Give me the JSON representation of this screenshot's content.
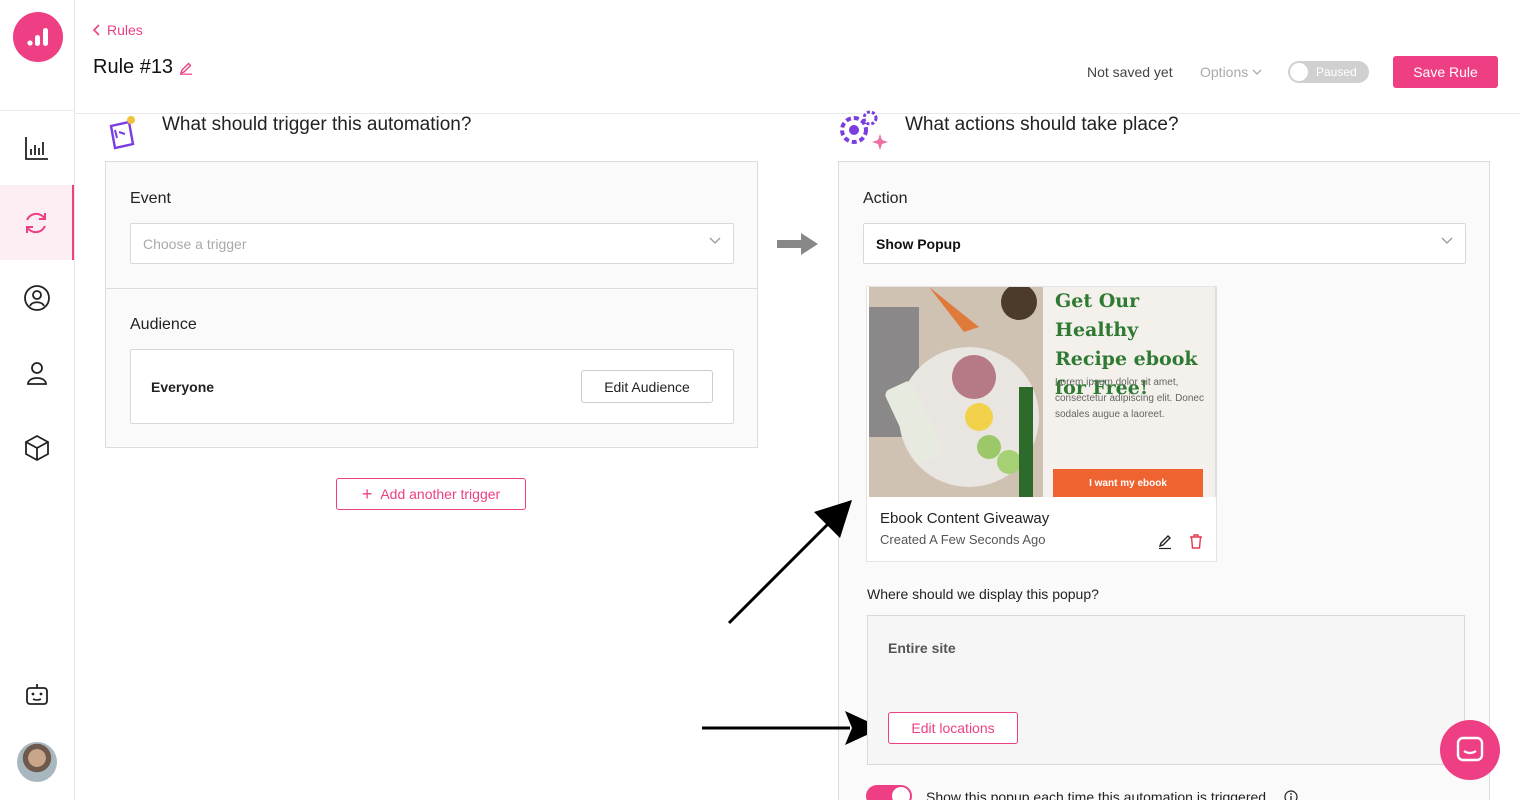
{
  "sidebar": {
    "items": [
      {
        "name": "analytics",
        "icon": "bar-chart-icon"
      },
      {
        "name": "automations",
        "icon": "refresh-icon",
        "active": true
      },
      {
        "name": "audience",
        "icon": "user-circle-icon"
      },
      {
        "name": "agent",
        "icon": "person-icon"
      },
      {
        "name": "products",
        "icon": "cube-icon"
      },
      {
        "name": "bot",
        "icon": "robot-icon"
      }
    ]
  },
  "header": {
    "breadcrumb": "Rules",
    "title": "Rule #13",
    "status": "Not saved yet",
    "options_label": "Options",
    "toggle_label": "Paused",
    "save_label": "Save Rule"
  },
  "trigger": {
    "heading": "What should trigger this automation?",
    "event_label": "Event",
    "event_placeholder": "Choose a trigger",
    "audience_label": "Audience",
    "audience_value": "Everyone",
    "edit_audience_label": "Edit Audience",
    "add_trigger_label": "Add another trigger"
  },
  "action": {
    "heading": "What actions should take place?",
    "action_label": "Action",
    "action_value": "Show Popup",
    "popup": {
      "title": "Get Our Healthy Recipe ebook for Free!",
      "body": "Lorem ipsum dolor sit amet, consectetur adipiscing elit. Donec sodales augue a laoreet.",
      "cta": "I want my ebook",
      "name": "Ebook Content Giveaway",
      "created": "Created A Few Seconds Ago"
    },
    "where_label": "Where should we display this popup?",
    "location_value": "Entire site",
    "edit_locations_label": "Edit locations",
    "show_each_time_label": "Show this popup each time this automation is triggered"
  },
  "colors": {
    "accent": "#ee3f84",
    "ebook_green": "#2f7a33",
    "cta_orange": "#ee6330"
  }
}
